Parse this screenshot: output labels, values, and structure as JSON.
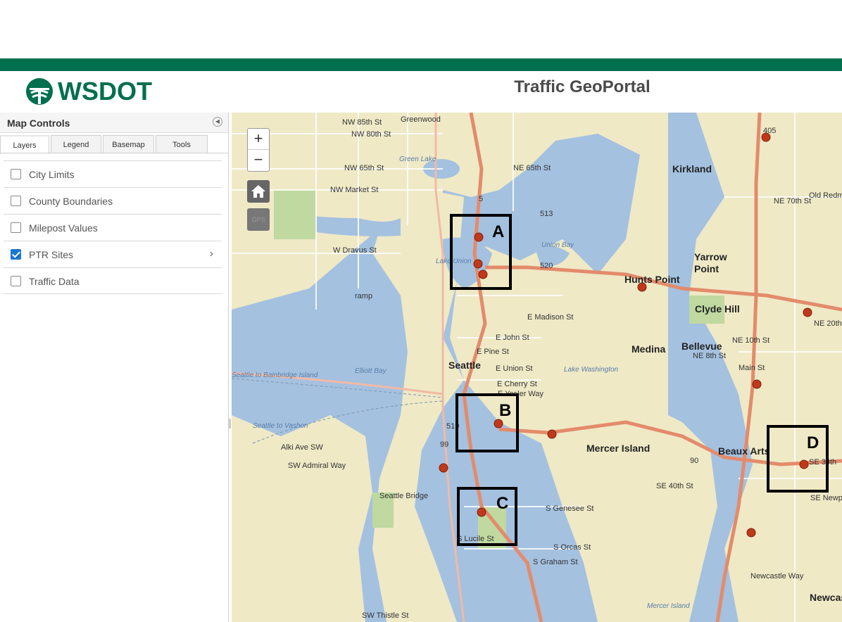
{
  "header": {
    "brand": "WSDOT",
    "title": "Traffic GeoPortal"
  },
  "panel": {
    "title": "Map Controls",
    "tabs": [
      {
        "label": "Layers",
        "active": true
      },
      {
        "label": "Legend",
        "active": false
      },
      {
        "label": "Basemap",
        "active": false
      },
      {
        "label": "Tools",
        "active": false
      }
    ],
    "layers": [
      {
        "label": "City Limits",
        "checked": false
      },
      {
        "label": "County Boundaries",
        "checked": false
      },
      {
        "label": "Milepost Values",
        "checked": false
      },
      {
        "label": "PTR Sites",
        "checked": true,
        "expandable": true
      },
      {
        "label": "Traffic Data",
        "checked": false
      }
    ]
  },
  "map": {
    "controls": {
      "zoom_in": "+",
      "zoom_out": "−",
      "gps": "GPS"
    },
    "places": [
      "Kirkland",
      "Yarrow",
      "Point",
      "Hunts Point",
      "Clyde Hill",
      "Medina",
      "Bellevue",
      "Seattle",
      "Mercer Island",
      "Beaux Arts",
      "Newcas"
    ],
    "streets": [
      "NW 85th St",
      "NW 80th St",
      "NW 65th St",
      "NW Market St",
      "W Dravus St",
      "E John St",
      "E Pine St",
      "E Union St",
      "E Cherry St",
      "E Yesler Way",
      "NE 65th St",
      "NE 70th St",
      "NE 20th St",
      "NE 10th St",
      "NE 8th St",
      "Main St",
      "SE 40th St",
      "S Genesee St",
      "S Orcas St",
      "S Graham St",
      "SW Admiral Way",
      "Seattle Bridge",
      "SW Thistle St",
      "Newcastle Way",
      "Old Redmo",
      "Alki Ave SW",
      "E Madison St",
      "S Lucile St",
      "Elliott Bay",
      "Union Bay",
      "Lake Washington",
      "Green Lake",
      "Lake Union",
      "Mercer Island",
      "Seattle to Bainbridge Island",
      "Seattle to Vashon",
      "ramp",
      "520",
      "513",
      "99",
      "519",
      "5",
      "90",
      "405",
      "SE 38th",
      "SE Newp",
      "Greenwood"
    ],
    "annotations": [
      "A",
      "B",
      "C",
      "D"
    ]
  },
  "colors": {
    "brand_green": "#006f4e",
    "checkbox_blue": "#1976d2",
    "water": "#a4c1e0",
    "land": "#efe9c6",
    "site_marker": "#c0391b"
  }
}
